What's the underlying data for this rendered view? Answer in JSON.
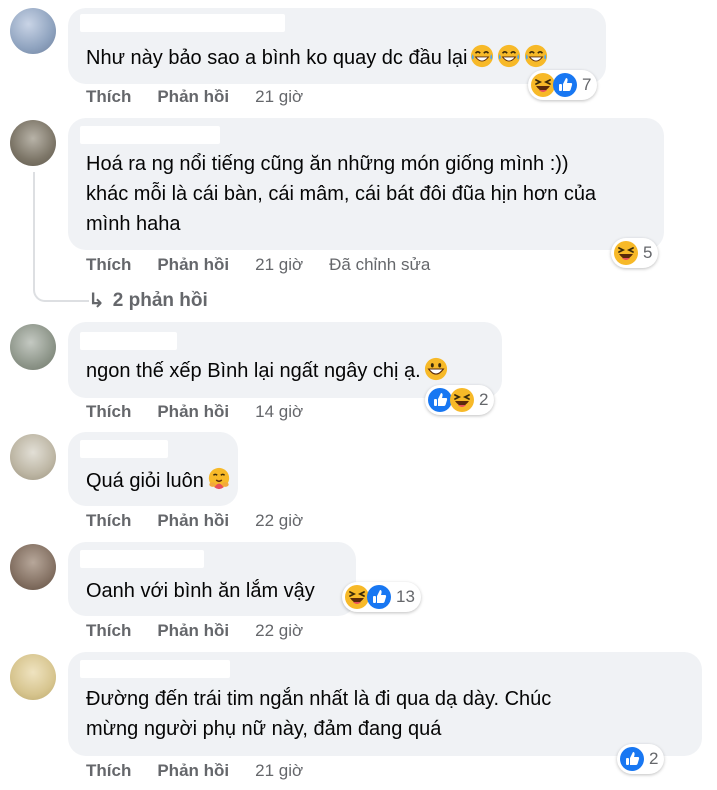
{
  "comments": [
    {
      "text_lines": [
        "Như này bảo sao a bình ko quay dc đầu lại"
      ],
      "actions": {
        "like": "Thích",
        "reply": "Phản hồi",
        "time": "21 giờ"
      },
      "reactions": {
        "icons": [
          "laugh-icon",
          "like-icon"
        ],
        "count": "7"
      }
    },
    {
      "text_lines": [
        "Hoá ra ng nổi tiếng cũng ăn những món giống mình :))",
        "khác mỗi là cái bàn, cái mâm, cái bát đôi đũa hịn hơn của",
        "mình haha"
      ],
      "actions": {
        "like": "Thích",
        "reply": "Phản hồi",
        "time": "21 giờ",
        "edited": "Đã chỉnh sửa"
      },
      "reactions": {
        "icons": [
          "laugh-icon"
        ],
        "count": "5"
      },
      "replies_label": "2 phản hồi"
    },
    {
      "text_lines": [
        "ngon thế xếp Bình lại ngất ngây chị ạ."
      ],
      "actions": {
        "like": "Thích",
        "reply": "Phản hồi",
        "time": "14 giờ"
      },
      "reactions": {
        "icons": [
          "like-icon",
          "laugh-icon"
        ],
        "count": "2"
      }
    },
    {
      "text_lines": [
        "Quá giỏi luôn"
      ],
      "actions": {
        "like": "Thích",
        "reply": "Phản hồi",
        "time": "22 giờ"
      }
    },
    {
      "text_lines": [
        "Oanh với bình ăn lắm vậy"
      ],
      "actions": {
        "like": "Thích",
        "reply": "Phản hồi",
        "time": "22 giờ"
      },
      "reactions": {
        "icons": [
          "laugh-icon",
          "like-icon"
        ],
        "count": "13"
      }
    },
    {
      "text_lines": [
        "Đường đến trái tim ngắn nhất là đi qua dạ dày. Chúc",
        "mừng người phụ nữ này, đảm đang quá"
      ],
      "actions": {
        "like": "Thích",
        "reply": "Phản hồi",
        "time": "21 giờ"
      },
      "reactions": {
        "icons": [
          "like-icon"
        ],
        "count": "2"
      }
    }
  ],
  "colors": {
    "bubble": "#f0f2f5",
    "like_blue": "#1877f2",
    "meta_gray": "#65676b",
    "emoji_yellow": "#f7b125"
  }
}
